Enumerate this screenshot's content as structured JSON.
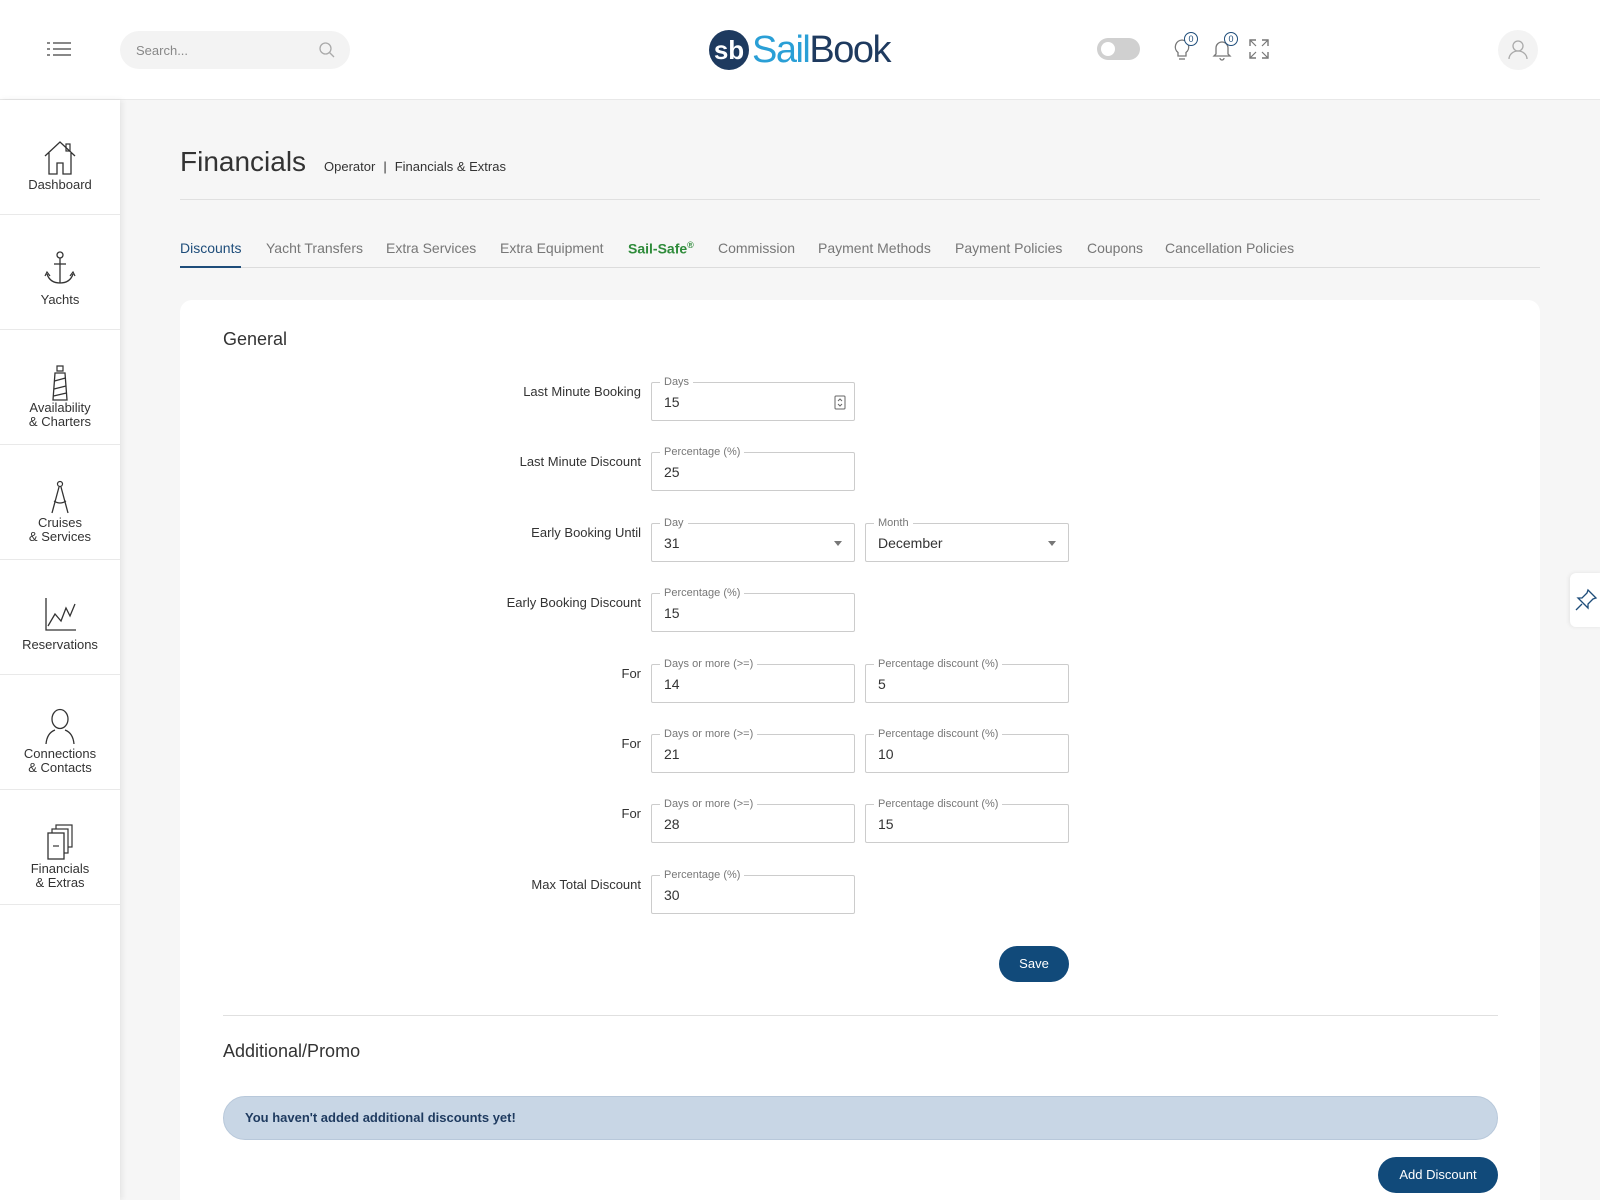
{
  "header": {
    "search_placeholder": "Search...",
    "logo_left": "Sail",
    "logo_right": "Book",
    "tips_count": "0",
    "notifications_count": "0"
  },
  "sidebar": {
    "items": [
      {
        "label": "Dashboard"
      },
      {
        "label": "Yachts"
      },
      {
        "label": "Availability\n& Charters"
      },
      {
        "label": "Cruises\n& Services"
      },
      {
        "label": "Reservations"
      },
      {
        "label": "Connections\n& Contacts"
      },
      {
        "label": "Financials\n& Extras"
      }
    ]
  },
  "page": {
    "title": "Financials",
    "breadcrumb_1": "Operator",
    "breadcrumb_sep": "|",
    "breadcrumb_2": "Financials & Extras"
  },
  "tabs": {
    "discounts": "Discounts",
    "yacht_transfers": "Yacht Transfers",
    "extra_services": "Extra Services",
    "extra_equipment": "Extra Equipment",
    "sail_safe": "Sail-Safe",
    "sail_safe_mark": "®",
    "commission": "Commission",
    "payment_methods": "Payment Methods",
    "payment_policies": "Payment Policies",
    "coupons": "Coupons",
    "cancellation_policies": "Cancellation Policies"
  },
  "general": {
    "title": "General",
    "last_minute_booking": {
      "label": "Last Minute Booking",
      "field_label": "Days",
      "value": "15"
    },
    "last_minute_discount": {
      "label": "Last Minute Discount",
      "field_label": "Percentage (%)",
      "value": "25"
    },
    "early_booking_until": {
      "label": "Early Booking Until",
      "day_label": "Day",
      "day_value": "31",
      "month_label": "Month",
      "month_value": "December"
    },
    "early_booking_discount": {
      "label": "Early Booking Discount",
      "field_label": "Percentage (%)",
      "value": "15"
    },
    "tiers": [
      {
        "label": "For",
        "days_label": "Days or more (>=)",
        "days_value": "14",
        "pct_label": "Percentage discount (%)",
        "pct_value": "5"
      },
      {
        "label": "For",
        "days_label": "Days or more (>=)",
        "days_value": "21",
        "pct_label": "Percentage discount (%)",
        "pct_value": "10"
      },
      {
        "label": "For",
        "days_label": "Days or more (>=)",
        "days_value": "28",
        "pct_label": "Percentage discount (%)",
        "pct_value": "15"
      }
    ],
    "max_total_discount": {
      "label": "Max Total Discount",
      "field_label": "Percentage (%)",
      "value": "30"
    },
    "save_label": "Save"
  },
  "additional": {
    "title": "Additional/Promo",
    "empty_message": "You haven't added additional discounts yet!",
    "add_label": "Add Discount"
  },
  "colors": {
    "primary": "#114a7a",
    "brand_light": "#2a9fd6",
    "brand_dark": "#1e3a5f",
    "sail_safe": "#2e8b3a",
    "alert_bg": "#c8d6e5"
  }
}
